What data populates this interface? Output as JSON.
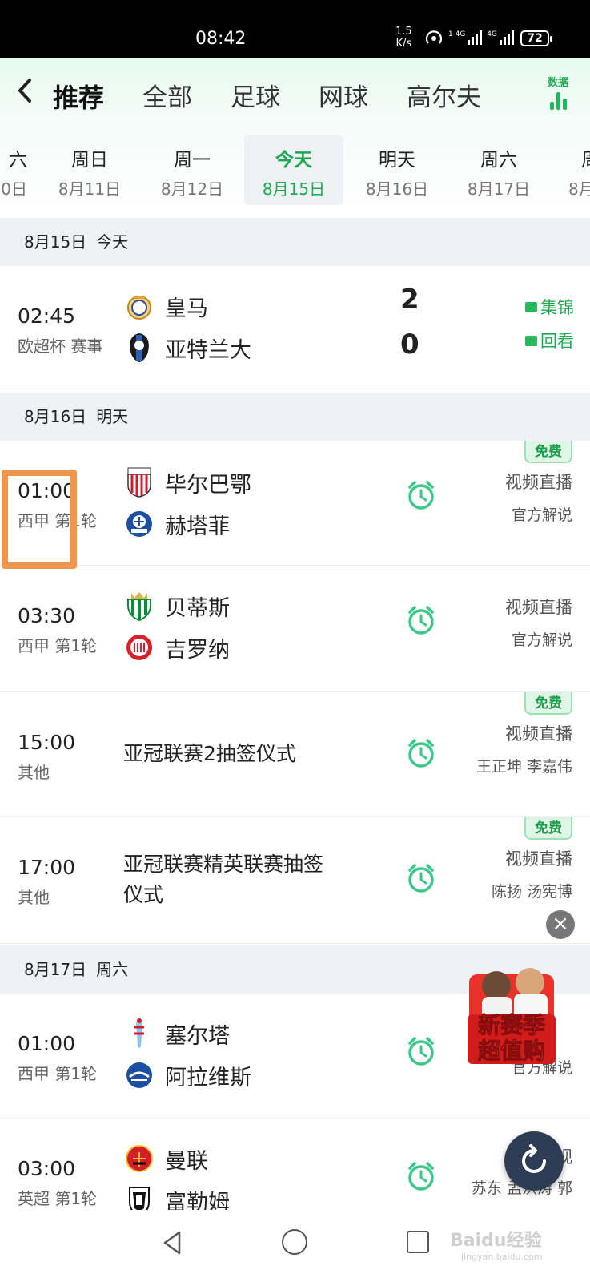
{
  "status_bar": {
    "time": "08:42",
    "net_speed_top": "1.5",
    "net_speed_bottom": "K/s",
    "sig1_label": "1 4G",
    "sig2_label": "4G",
    "battery": "72"
  },
  "header": {
    "back_icon": "chevron-left-icon",
    "tabs": [
      "推荐",
      "全部",
      "足球",
      "网球",
      "高尔夫"
    ],
    "active_tab": "推荐",
    "data_label": "数据"
  },
  "day_tabs": [
    {
      "weekday": "六",
      "date": "0日"
    },
    {
      "weekday": "周日",
      "date": "8月11日"
    },
    {
      "weekday": "周一",
      "date": "8月12日"
    },
    {
      "weekday": "今天",
      "date": "8月15日",
      "active": true
    },
    {
      "weekday": "明天",
      "date": "8月16日"
    },
    {
      "weekday": "周六",
      "date": "8月17日"
    },
    {
      "weekday": "周",
      "date": "8月"
    }
  ],
  "sections": [
    {
      "date": "8月15日",
      "label": "今天"
    },
    {
      "date": "8月16日",
      "label": "明天"
    },
    {
      "date": "8月17日",
      "label": "周六"
    }
  ],
  "matches": [
    {
      "time": "02:45",
      "league": "欧超杯 赛事",
      "home": "皇马",
      "away": "亚特兰大",
      "home_score": "2",
      "away_score": "0",
      "highlights": "集锦",
      "replay": "回看"
    },
    {
      "time": "01:00",
      "league": "西甲 第1轮",
      "home": "毕尔巴鄂",
      "away": "赫塔菲",
      "badge": "免费",
      "live": "视频直播",
      "commentary": "官方解说"
    },
    {
      "time": "03:30",
      "league": "西甲 第1轮",
      "home": "贝蒂斯",
      "away": "吉罗纳",
      "live": "视频直播",
      "commentary": "官方解说"
    },
    {
      "time": "15:00",
      "league": "其他",
      "title": "亚冠联赛2抽签仪式",
      "badge": "免费",
      "live": "视频直播",
      "commentary": "王正坤 李嘉伟"
    },
    {
      "time": "17:00",
      "league": "其他",
      "title_line1": "亚冠联赛精英联赛抽签",
      "title_line2": "仪式",
      "badge": "免费",
      "live": "视频直播",
      "commentary": "陈扬 汤宪博"
    },
    {
      "time": "01:00",
      "league": "西甲 第1轮",
      "home": "塞尔塔",
      "away": "阿拉维斯",
      "commentary": "官方解说"
    },
    {
      "time": "03:00",
      "league": "英超 第1轮",
      "home": "曼联",
      "away": "富勒姆",
      "live_partial": "视",
      "commentary": "苏东 孟洪涛 郭"
    }
  ],
  "ad": {
    "line1": "新赛季",
    "line2": "超值购",
    "close": "×"
  },
  "watermark": {
    "main": "Baidu经验",
    "sub": "jingyan.baidu.com"
  },
  "colors": {
    "accent": "#1ea951",
    "highlight_box": "#f1954a",
    "section_bg": "#eef1f6"
  }
}
